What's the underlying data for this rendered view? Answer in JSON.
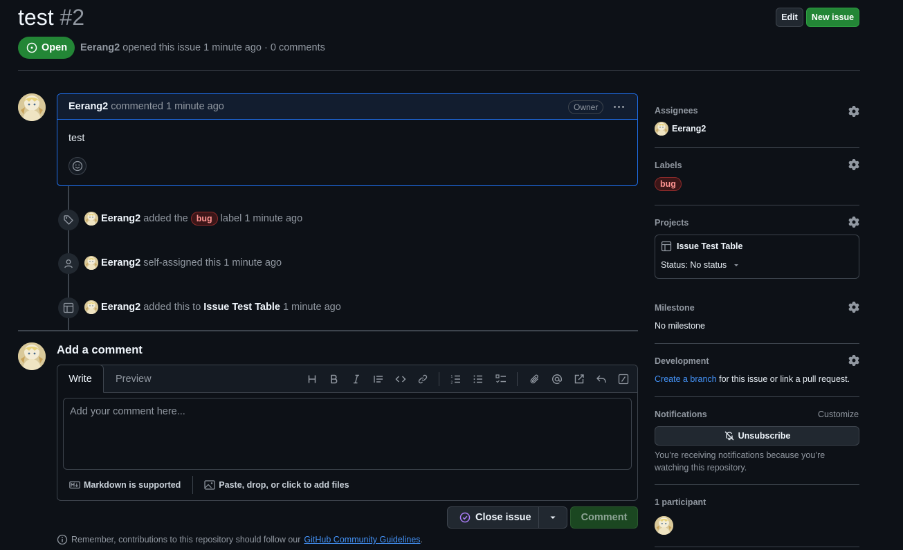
{
  "issue": {
    "title": "test",
    "number": "#2",
    "state": "Open",
    "author": "Eerang2",
    "meta_rest": "opened this issue 1 minute ago · 0 comments"
  },
  "header": {
    "edit_label": "Edit",
    "new_issue_label": "New issue"
  },
  "comment": {
    "author": "Eerang2",
    "action": "commented 1 minute ago",
    "owner_badge": "Owner",
    "body": "test"
  },
  "timeline": [
    {
      "actor": "Eerang2",
      "pre": "added the",
      "label": "bug",
      "post": "label 1 minute ago"
    },
    {
      "actor": "Eerang2",
      "pre": "self-assigned this 1 minute ago"
    },
    {
      "actor": "Eerang2",
      "pre": "added this to",
      "target": "Issue Test Table",
      "post": "1 minute ago"
    }
  ],
  "add_comment": {
    "title": "Add a comment",
    "tab_write": "Write",
    "tab_preview": "Preview",
    "placeholder": "Add your comment here...",
    "markdown_note": "Markdown is supported",
    "files_note": "Paste, drop, or click to add files",
    "close_issue": "Close issue",
    "comment_button": "Comment",
    "remember_pre": "Remember, contributions to this repository should follow our",
    "remember_link": "GitHub Community Guidelines",
    "remember_post": "."
  },
  "sidebar": {
    "assignees": {
      "heading": "Assignees",
      "name": "Eerang2"
    },
    "labels": {
      "heading": "Labels",
      "label": "bug"
    },
    "projects": {
      "heading": "Projects",
      "name": "Issue Test Table",
      "status": "Status: No status"
    },
    "milestone": {
      "heading": "Milestone",
      "value": "No milestone"
    },
    "development": {
      "heading": "Development",
      "link": "Create a branch",
      "rest": "for this issue or link a pull request."
    },
    "notifications": {
      "heading": "Notifications",
      "customize": "Customize",
      "unsubscribe": "Unsubscribe",
      "note": "You’re receiving notifications because you’re watching this repository."
    },
    "participants": {
      "heading": "1 participant"
    }
  },
  "colors": {
    "bg": "#0d1117",
    "accent_green": "#238636",
    "link": "#4493f8",
    "bug_label": "#ff9492"
  }
}
